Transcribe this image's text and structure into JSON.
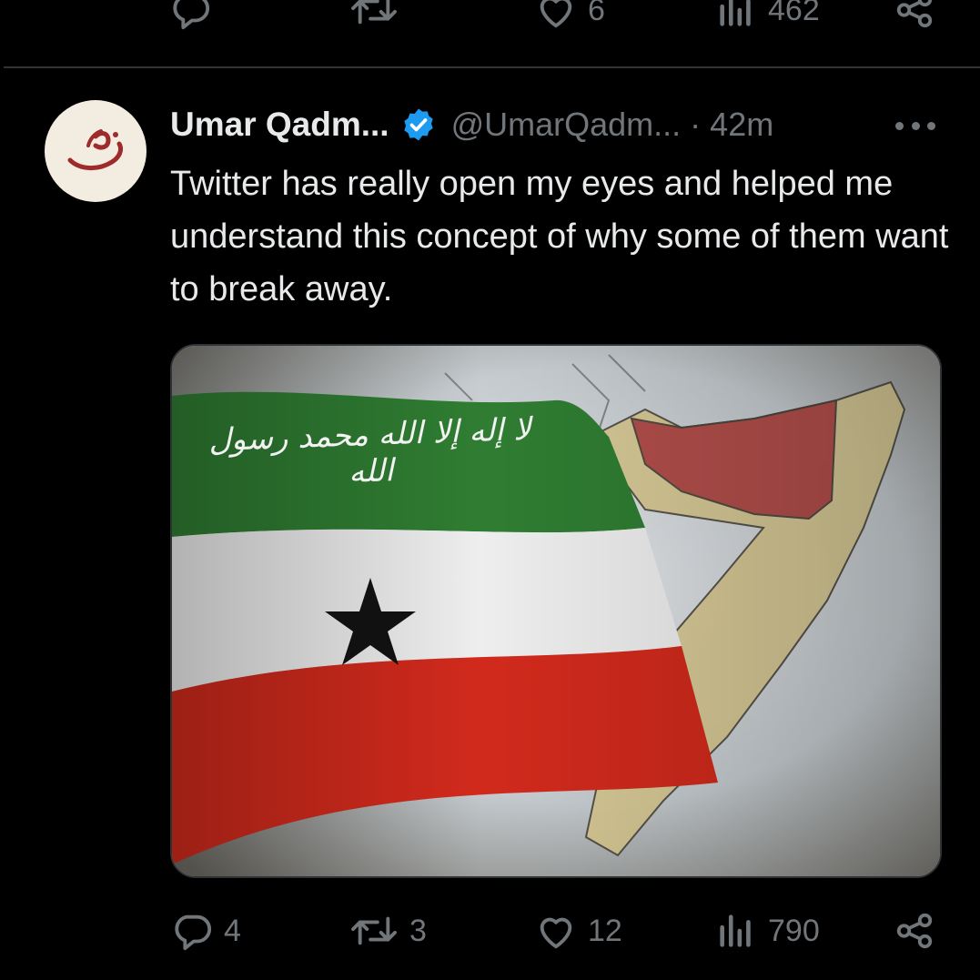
{
  "prev_tweet": {
    "actions": [
      {
        "name": "reply",
        "count": ""
      },
      {
        "name": "retweet",
        "count": ""
      },
      {
        "name": "like",
        "count": "6"
      },
      {
        "name": "views",
        "count": "462"
      },
      {
        "name": "share",
        "count": ""
      }
    ]
  },
  "tweet": {
    "display_name": "Umar Qadm...",
    "handle": "@UmarQadm...",
    "separator": "·",
    "time": "42m",
    "text": "Twitter has really open my eyes and helped me understand this concept of why some of them want to break away.",
    "image_alt": "Somaliland flag beside a map of Somalia",
    "flag_inscription": "لا إله إلا الله محمد رسول الله",
    "actions": {
      "reply_count": "4",
      "retweet_count": "3",
      "like_count": "12",
      "views_count": "790"
    }
  },
  "colors": {
    "background": "#000000",
    "text_primary": "#e7e9ea",
    "text_secondary": "#71767b",
    "verified": "#1d9bf0",
    "divider": "#2f3336"
  },
  "icons": [
    "reply-icon",
    "retweet-icon",
    "like-icon",
    "views-icon",
    "share-icon",
    "verified-badge-icon",
    "more-icon"
  ]
}
